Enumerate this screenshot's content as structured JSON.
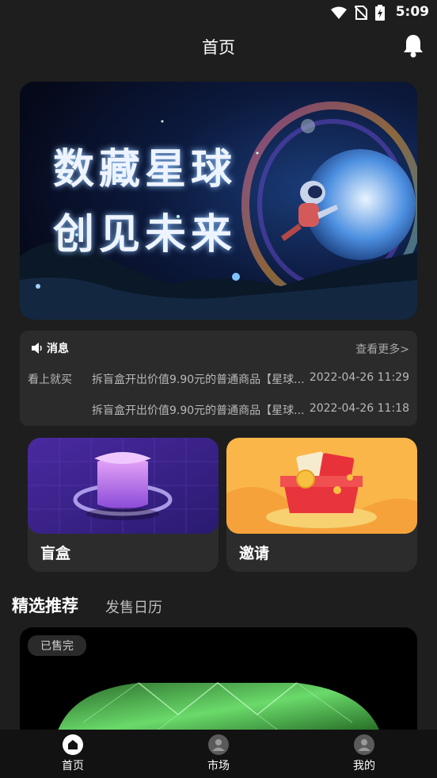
{
  "status": {
    "time": "5:09"
  },
  "header": {
    "title": "首页"
  },
  "banner": {
    "line1": "数藏星球",
    "line2": "创见未来"
  },
  "news": {
    "title": "消息",
    "more": "查看更多>",
    "items": [
      {
        "tag": "看上就买",
        "text": "拆盲盒开出价值9.90元的普通商品【星球...",
        "time": "2022-04-26 11:29"
      },
      {
        "tag": "",
        "text": "拆盲盒开出价值9.90元的普通商品【星球...",
        "time": "2022-04-26 11:18"
      }
    ]
  },
  "cards": {
    "blindbox": "盲盒",
    "invite": "邀请"
  },
  "sections": {
    "featured": "精选推荐",
    "calendar": "发售日历"
  },
  "product": {
    "badge": "已售完"
  },
  "tabs": [
    {
      "label": "首页"
    },
    {
      "label": "市场"
    },
    {
      "label": "我的"
    }
  ]
}
